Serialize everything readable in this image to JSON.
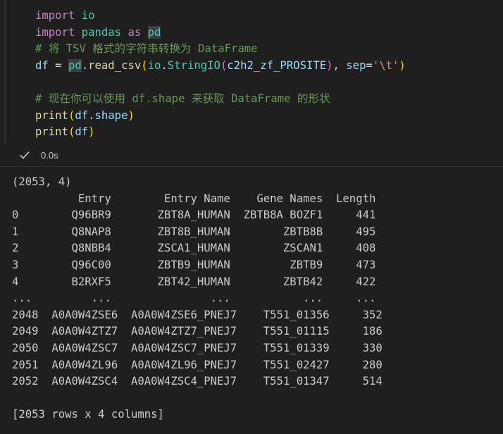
{
  "code_cell": {
    "lines": [
      "import io",
      "import pandas as pd",
      "# 将 TSV 格式的字符串转换为 DataFrame",
      "df = pd.read_csv(io.StringIO(c2h2_zf_PROSITE), sep='\\t')",
      "",
      "# 现在你可以使用 df.shape 来获取 DataFrame 的形状",
      "print(df.shape)",
      "print(df)"
    ],
    "status_icon": "check-icon",
    "exec_time": "0.0s"
  },
  "output": {
    "lines": [
      "(2053, 4)",
      "          Entry        Entry Name    Gene Names  Length",
      "0        Q96BR9       ZBT8A_HUMAN  ZBTB8A BOZF1     441",
      "1        Q8NAP8       ZBT8B_HUMAN        ZBTB8B     495",
      "2        Q8NBB4       ZSCA1_HUMAN        ZSCAN1     408",
      "3        Q96C00       ZBTB9_HUMAN         ZBTB9     473",
      "4        B2RXF5       ZBT42_HUMAN        ZBTB42     422",
      "...         ...               ...           ...     ...",
      "2048  A0A0W4ZSE6  A0A0W4ZSE6_PNEJ7    T551_01356     352",
      "2049  A0A0W4ZTZ7  A0A0W4ZTZ7_PNEJ7    T551_01115     186",
      "2050  A0A0W4ZSC7  A0A0W4ZSC7_PNEJ7    T551_01339     330",
      "2051  A0A0W4ZL96  A0A0W4ZL96_PNEJ7    T551_02427     280",
      "2052  A0A0W4ZSC4  A0A0W4ZSC4_PNEJ7    T551_01347     514",
      "",
      "[2053 rows x 4 columns]"
    ]
  },
  "colors": {
    "background": "#1f1f1f",
    "keyword": "#c586c0",
    "module": "#4ec9b0",
    "variable": "#9cdcfe",
    "function": "#dcdcaa",
    "string": "#ce9178",
    "comment": "#6a9955",
    "text": "#cccccc"
  }
}
